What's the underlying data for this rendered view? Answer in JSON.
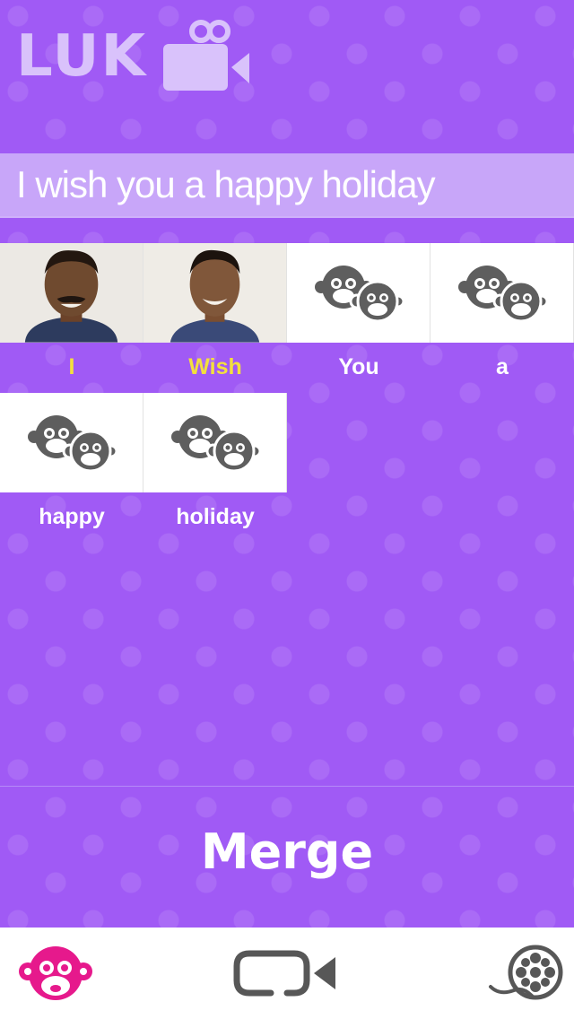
{
  "header": {
    "logo_text": "LUK",
    "logo_icon": "video-camera-icon"
  },
  "sentence": {
    "text": "I wish you a happy holiday"
  },
  "words": [
    {
      "label": "I",
      "thumbnail": "person-photo",
      "active": true
    },
    {
      "label": "Wish",
      "thumbnail": "person-photo",
      "active": true
    },
    {
      "label": "You",
      "thumbnail": "monkey-placeholder-icon",
      "active": false
    },
    {
      "label": "a",
      "thumbnail": "monkey-placeholder-icon",
      "active": false
    },
    {
      "label": "happy",
      "thumbnail": "monkey-placeholder-icon",
      "active": false
    },
    {
      "label": "holiday",
      "thumbnail": "monkey-placeholder-icon",
      "active": false
    }
  ],
  "actions": {
    "merge_label": "Merge"
  },
  "tabbar": {
    "tabs": [
      {
        "icon": "monkey-face-icon",
        "active": true
      },
      {
        "icon": "video-camera-icon",
        "active": false
      },
      {
        "icon": "film-reel-icon",
        "active": false
      }
    ]
  },
  "colors": {
    "background": "#a05af5",
    "active_word": "#f3e03c",
    "active_tab": "#e6198c"
  }
}
